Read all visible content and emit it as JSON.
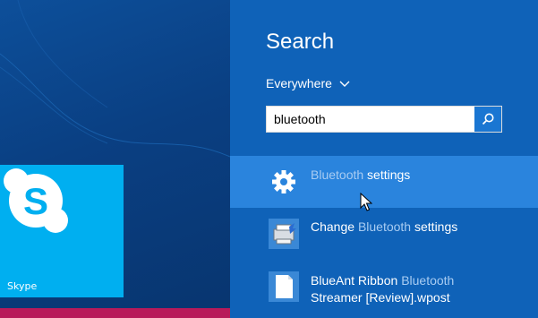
{
  "start": {
    "tile": {
      "label": "Skype"
    }
  },
  "search": {
    "title": "Search",
    "scope": "Everywhere",
    "query": "bluetooth",
    "results": [
      {
        "match": "Bluetooth",
        "rest": " settings",
        "icon": "gear-icon"
      },
      {
        "prefix": "Change ",
        "match": "Bluetooth",
        "rest": " settings",
        "icon": "control-panel-icon"
      },
      {
        "line1_prefix": "BlueAnt Ribbon ",
        "line1_match": "Bluetooth",
        "line2": "Streamer [Review].wpost",
        "icon": "document-icon"
      }
    ]
  },
  "colors": {
    "charm_bg": "#0f62b8",
    "selected_bg": "#2a84dd",
    "highlight_text": "#a8ccf2",
    "skype_tile": "#00aff0"
  }
}
